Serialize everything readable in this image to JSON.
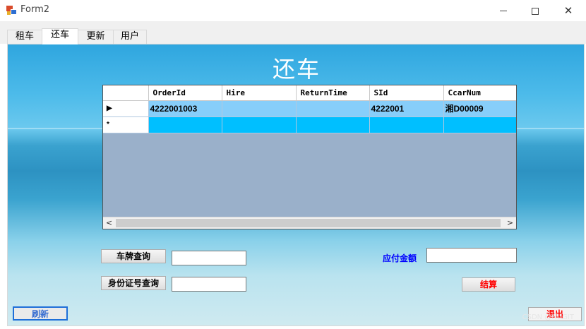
{
  "window": {
    "title": "Form2",
    "min_glyph": "",
    "max_glyph": "",
    "close_glyph": "✕"
  },
  "tabs": [
    {
      "label": "租车"
    },
    {
      "label": "还车"
    },
    {
      "label": "更新"
    },
    {
      "label": "用户"
    }
  ],
  "page": {
    "heading": "还车"
  },
  "grid": {
    "columns": [
      "OrderId",
      "Hire",
      "ReturnTime",
      "SId",
      "CcarNum"
    ],
    "rows": [
      {
        "marker": "▶",
        "cells": [
          "4222001003",
          "",
          "",
          "4222001",
          "湘D00009"
        ]
      },
      {
        "marker": "*",
        "cells": [
          "",
          "",
          "",
          "",
          ""
        ]
      }
    ],
    "scroll_left": "<",
    "scroll_right": ">"
  },
  "form": {
    "plate_query_button": "车牌查询",
    "plate_query_input": "",
    "id_query_button": "身份证号查询",
    "id_query_input": "",
    "amount_label": "应付金额",
    "amount_input": "",
    "settle_button": "结算",
    "refresh_button": "刷新",
    "exit_button": "退出"
  },
  "watermark": "CSDN @HUGIT",
  "colors": {
    "row_selected": "#87cefa",
    "row_new": "#00bfff",
    "grid_background": "#9ab0ca",
    "label_blue": "#0000ff",
    "button_red": "#ff0000"
  }
}
